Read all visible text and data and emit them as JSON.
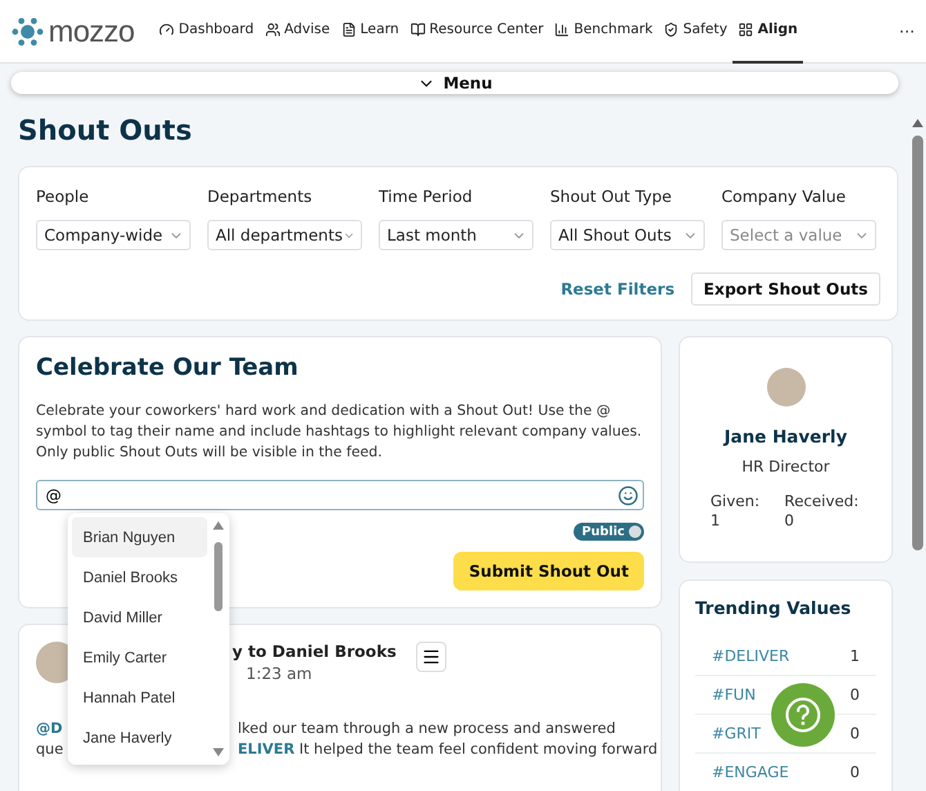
{
  "brand": {
    "name": "mozzo"
  },
  "nav": [
    {
      "label": "Dashboard",
      "selected": false
    },
    {
      "label": "Advise",
      "selected": false
    },
    {
      "label": "Learn",
      "selected": false
    },
    {
      "label": "Resource Center",
      "selected": false
    },
    {
      "label": "Benchmark",
      "selected": false
    },
    {
      "label": "Safety",
      "selected": false
    },
    {
      "label": "Align",
      "selected": true
    }
  ],
  "nav_more": "···",
  "menu_bar": {
    "label": "Menu"
  },
  "page_title": "Shout Outs",
  "filters": [
    {
      "label": "People",
      "value": "Company-wide"
    },
    {
      "label": "Departments",
      "value": "All departments"
    },
    {
      "label": "Time Period",
      "value": "Last month"
    },
    {
      "label": "Shout Out Type",
      "value": "All Shout Outs"
    },
    {
      "label": "Company Value",
      "placeholder": "Select a value"
    }
  ],
  "reset_link": "Reset Filters",
  "export_button": "Export Shout Outs",
  "composer": {
    "title": "Celebrate Our Team",
    "description": "Celebrate your coworkers' hard work and dedication with a Shout Out! Use the @ symbol to tag their name and include hashtags to highlight relevant company values. Only public Shout Outs will be visible in the feed.",
    "value": "@",
    "public_toggle": {
      "label": "Public",
      "on": true
    },
    "submit": "Submit Shout Out"
  },
  "mention_menu": [
    {
      "name": "Brian Nguyen",
      "selected": true
    },
    {
      "name": "Daniel Brooks",
      "selected": false
    },
    {
      "name": "David Miller",
      "selected": false
    },
    {
      "name": "Emily Carter",
      "selected": false
    },
    {
      "name": "Hannah Patel",
      "selected": false
    },
    {
      "name": "Jane Haverly",
      "selected": false
    }
  ],
  "post": {
    "title": "y to Daniel Brooks",
    "time": "1:23 am",
    "lines": [
      {
        "start": "@D",
        "rest": "lked our team through a new process and answered"
      },
      {
        "start": "que",
        "rest": "**ELIVER** It helped the team feel confident moving forward"
      }
    ]
  },
  "profile": {
    "name": "Jane Haverly",
    "role": "HR Director",
    "stats": [
      {
        "label": "Given:",
        "value": "1"
      },
      {
        "label": "Received:",
        "value": "0"
      }
    ]
  },
  "trending": {
    "title": "Trending Values",
    "rows": [
      {
        "tag": "#DELIVER",
        "count": "1"
      },
      {
        "tag": "#FUN",
        "count": "0"
      },
      {
        "tag": "#GRIT",
        "count": "0"
      },
      {
        "tag": "#ENGAGE",
        "count": "0"
      }
    ]
  }
}
